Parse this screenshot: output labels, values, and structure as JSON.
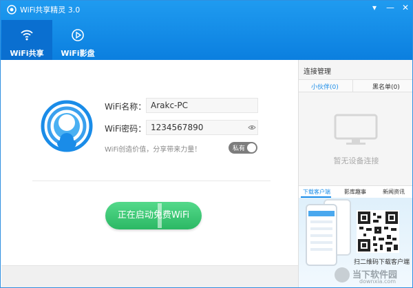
{
  "app": {
    "title": "WiFi共享精灵 3.0",
    "accent": "#1a8ce8",
    "window_controls": [
      "▾",
      "—",
      "✕"
    ]
  },
  "nav": {
    "tabs": [
      {
        "label": "WiFi共享",
        "icon": "wifi-icon",
        "active": true
      },
      {
        "label": "WiFi影盘",
        "icon": "play-circle-icon",
        "active": false
      }
    ]
  },
  "main": {
    "wifi_name_label": "WiFi名称：",
    "wifi_name_value": "Arakc-PC",
    "wifi_pwd_label": "WiFi密码：",
    "wifi_pwd_value": "1234567890",
    "slogan": "WiFi创造价值，分享带来力量！",
    "privacy_toggle": "私有",
    "start_button": "正在启动免费WiFi",
    "start_button_color": "#2cb864"
  },
  "side": {
    "title": "连接管理",
    "tabs": [
      "小伙伴(0)",
      "黑名单(0)"
    ],
    "empty_text": "暂无设备连接",
    "sub_tabs": [
      "下载客户端",
      "影库趣事",
      "新闻资讯"
    ],
    "promo_text": "扫二维码下载客户端",
    "watermark": "当下软件园",
    "watermark_sub": "downxia.com"
  }
}
